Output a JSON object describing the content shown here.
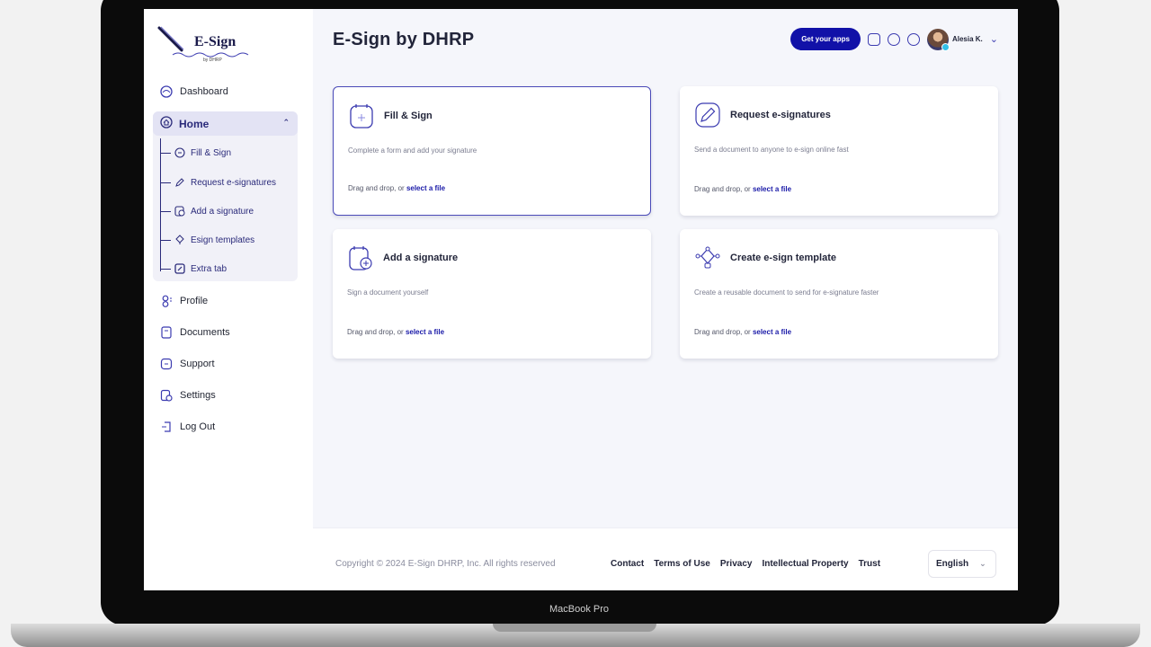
{
  "device_label": "MacBook Pro",
  "logo": {
    "text": "E-Sign",
    "sub": "by DHRP"
  },
  "sidebar": {
    "items_top": [
      {
        "label": "Dashboard",
        "icon": "dashboard-icon"
      }
    ],
    "home": {
      "label": "Home",
      "sub_items": [
        {
          "label": "Fill & Sign",
          "icon": "fill-sign-icon"
        },
        {
          "label": "Request e-signatures",
          "icon": "pen-icon"
        },
        {
          "label": "Add a signature",
          "icon": "add-signature-icon"
        },
        {
          "label": "Esign templates",
          "icon": "template-icon"
        },
        {
          "label": "Extra tab",
          "icon": "extra-tab-icon"
        }
      ]
    },
    "items_bottom": [
      {
        "label": "Profile",
        "icon": "profile-icon"
      },
      {
        "label": "Documents",
        "icon": "documents-icon"
      },
      {
        "label": "Support",
        "icon": "support-icon"
      },
      {
        "label": "Settings",
        "icon": "settings-icon"
      },
      {
        "label": "Log Out",
        "icon": "logout-icon"
      }
    ]
  },
  "header": {
    "title": "E-Sign by DHRP",
    "apps_button": "Get your apps",
    "user_name": "Alesia K."
  },
  "cards": [
    {
      "title": "Fill & Sign",
      "desc": "Complete a form and add your signature",
      "drop_text": "Drag and drop, or ",
      "drop_link": "select a file"
    },
    {
      "title": "Request e-signatures",
      "desc": "Send a document to anyone to e-sign online fast",
      "drop_text": "Drag and drop, or ",
      "drop_link": "select a file"
    },
    {
      "title": "Add a signature",
      "desc": "Sign a document yourself",
      "drop_text": "Drag and drop, or ",
      "drop_link": "select a file"
    },
    {
      "title": "Create e-sign template",
      "desc": "Create a reusable document to send for e-signature faster",
      "drop_text": "Drag and drop, or ",
      "drop_link": "select a file"
    }
  ],
  "footer": {
    "copyright": "Copyright © 2024 E-Sign DHRP, Inc. All rights reserved",
    "links": [
      "Contact",
      "Terms of Use",
      "Privacy",
      "Intellectual Property",
      "Trust"
    ],
    "language": "English"
  },
  "colors": {
    "accent": "#1111a8",
    "sidebar_active": "#e3e3f4",
    "background": "#f5f6fb"
  }
}
